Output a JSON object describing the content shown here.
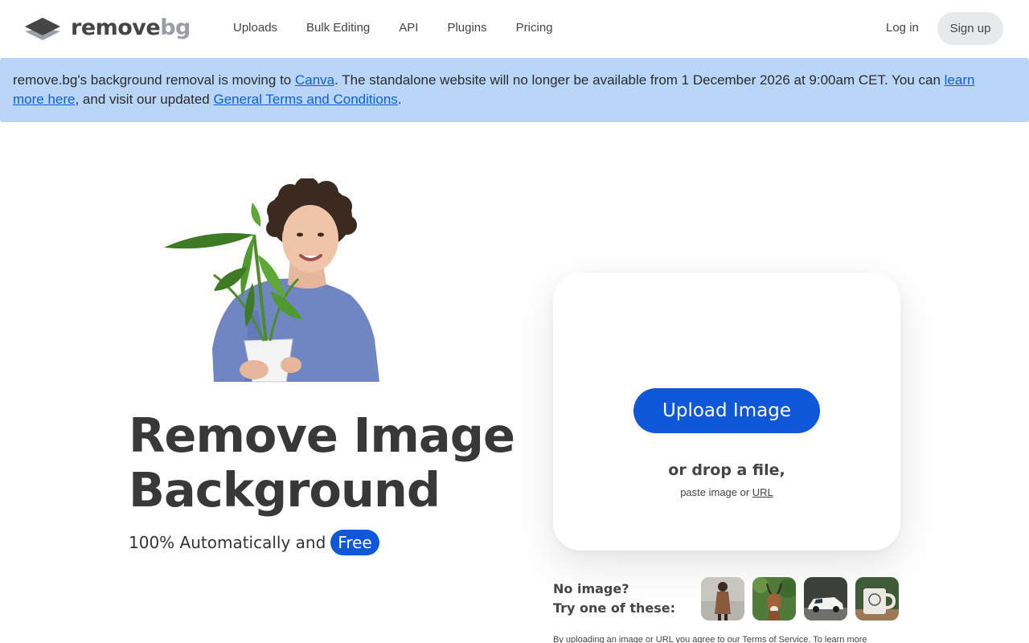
{
  "brand": {
    "name_part1": "remove",
    "name_part2": "bg",
    "accent_color": "#0e57d8"
  },
  "nav": {
    "items": [
      "Uploads",
      "Bulk Editing",
      "API",
      "Plugins",
      "Pricing"
    ],
    "login": "Log in",
    "signup": "Sign up"
  },
  "banner": {
    "text1": "remove.bg's background removal is moving to ",
    "link1": "Canva",
    "text2": ". The standalone website will no longer be available from 1 December 2026 at 9:00am CET. You can ",
    "link2": "learn more here",
    "text3": ", and visit our updated ",
    "link3": "General Terms and Conditions",
    "text4": ".",
    "background_color": "#b9d6f8"
  },
  "hero": {
    "title_line1": "Remove Image",
    "title_line2": "Background",
    "subtitle": "100% Automatically and",
    "badge": "Free"
  },
  "upload": {
    "button": "Upload Image",
    "drop_text": "or drop a file,",
    "paste_text": "paste image or ",
    "url_link": "URL"
  },
  "samples": {
    "label_line1": "No image?",
    "label_line2": "Try one of these:",
    "thumbnails": [
      "sample-woman",
      "sample-deer",
      "sample-car",
      "sample-mug"
    ]
  },
  "legal": {
    "text": "By uploading an image or URL you agree to our Terms of Service. To learn more"
  }
}
